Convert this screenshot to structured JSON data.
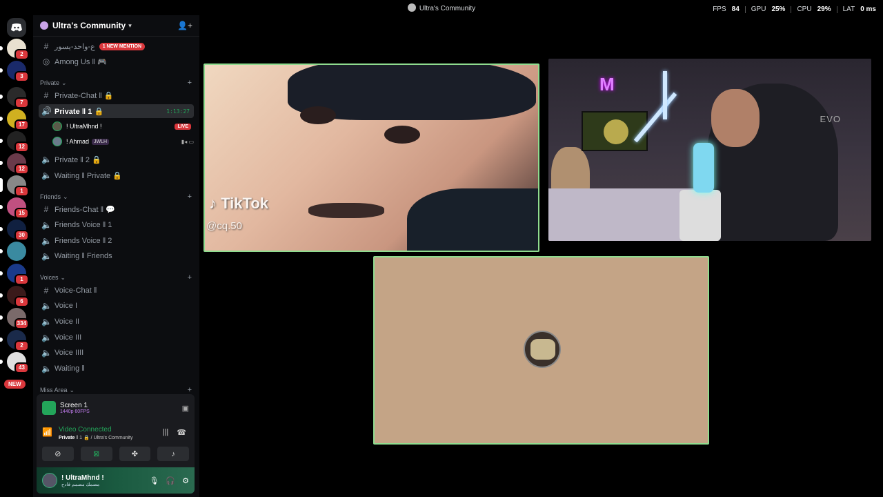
{
  "window": {
    "title": "Ultra's Community",
    "perf": {
      "fps_label": "FPS",
      "fps": "84",
      "gpu_label": "GPU",
      "gpu": "25%",
      "cpu_label": "CPU",
      "cpu": "29%",
      "lat_label": "LAT",
      "lat": "0 ms"
    }
  },
  "rail": {
    "badges": [
      "2",
      "3",
      "7",
      "2",
      "17",
      "12",
      "12",
      "1",
      "15",
      "30",
      "1",
      "6",
      "334",
      "2",
      "43"
    ],
    "new_label": "NEW"
  },
  "guild": {
    "name": "Ultra's Community"
  },
  "channels": {
    "mention_channel": "ع-واحد-يسور",
    "mention_badge": "1 NEW MENTION",
    "among_us": "Among Us ‖ 🎮",
    "cat_private": "Private",
    "private_chat": "Private-Chat ‖ 🔒",
    "private_1": "Private ‖ 1 🔒",
    "private_1_timer": "1:13:27",
    "member_1": "! UltraMhnd !",
    "member_1_live": "LIVE",
    "member_2": "! Ahmad",
    "member_2_tag": "JWLH",
    "private_2": "Private ‖ 2 🔒",
    "waiting_private": "Waiting ‖ Private 🔒",
    "cat_friends": "Friends",
    "friends_chat": "Friends-Chat ‖ 💬",
    "friends_voice_1": "Friends Voice ‖ 1",
    "friends_voice_2": "Friends Voice ‖ 2",
    "waiting_friends": "Waiting ‖ Friends",
    "cat_voices": "Voices",
    "voice_chat": "Voice-Chat ‖",
    "voice_1": "Voice I",
    "voice_2": "Voice II",
    "voice_3": "Voice III",
    "voice_4": "Voice IIII",
    "waiting": "Waiting ‖",
    "cat_miss": "Miss Area"
  },
  "voice_panel": {
    "screen_title": "Screen 1",
    "screen_quality": "1440p 60FPS",
    "status": "Video Connected",
    "channel": "Private",
    "channel_rest": " ‖ 1 🔒 / Ultra's Community",
    "user_name": "! UltraMhnd !",
    "user_status": "مصمك مصمم قادح"
  },
  "video": {
    "tiktok_label": "TikTok",
    "tiktok_handle": "@cq.50",
    "brand_text": "EVO"
  }
}
